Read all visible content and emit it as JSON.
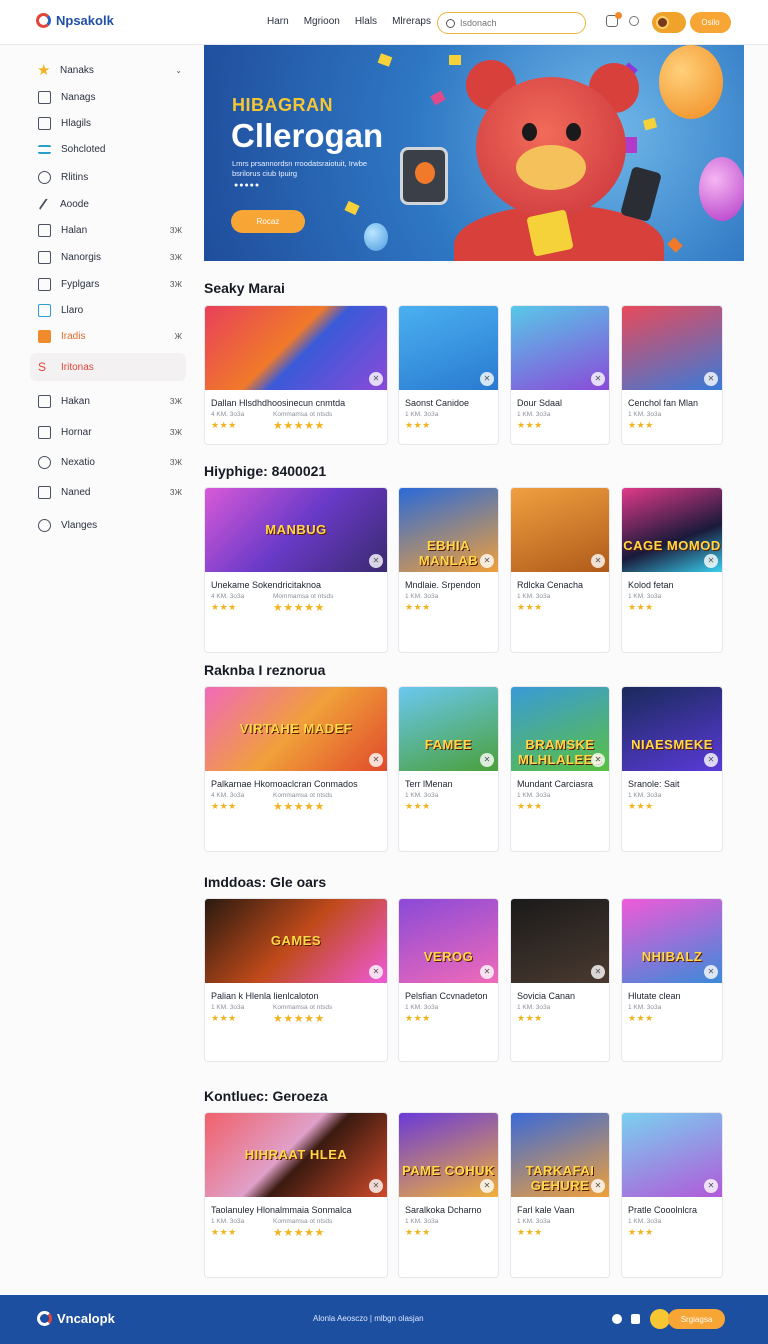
{
  "header": {
    "logo_text": "Npsakolk",
    "nav": [
      "Harn",
      "Mgrioon",
      "Hlals",
      "Mlreraps"
    ],
    "search_placeholder": "Isdonach",
    "login_label": "Osilo"
  },
  "sidebar": {
    "items": [
      {
        "label": "Nanaks",
        "tail": "⌄"
      },
      {
        "label": "Nanags",
        "tail": ""
      },
      {
        "label": "Hlagils",
        "tail": ""
      },
      {
        "label": "Sohcloted",
        "tail": ""
      },
      {
        "label": "Rlitins",
        "tail": ""
      },
      {
        "label": "Aoode",
        "tail": ""
      },
      {
        "label": "Halan",
        "tail": "ЗЖ"
      },
      {
        "label": "Nanorgis",
        "tail": "ЗЖ"
      },
      {
        "label": "Fyplgars",
        "tail": "ЗЖ"
      },
      {
        "label": "Llaro",
        "tail": ""
      },
      {
        "label": "Iradis",
        "tail": "Ж"
      },
      {
        "label": "Iritonas",
        "tail": ""
      },
      {
        "label": "Hakan",
        "tail": "ЗЖ"
      },
      {
        "label": "Hornar",
        "tail": "ЗЖ"
      },
      {
        "label": "Nexatio",
        "tail": "ЗЖ"
      },
      {
        "label": "Naned",
        "tail": "ЗЖ"
      },
      {
        "label": "Vlanges",
        "tail": ""
      }
    ]
  },
  "hero": {
    "kicker": "HIBAGRAN",
    "title": "Cllerogan",
    "subtitle": "Lmrs prsannordsn rroodatsraiotuit, Irwbe bsrilorus ciub Ipuirg",
    "dots": "●●●●●",
    "button": "Rocaz"
  },
  "sections": [
    {
      "title": "Seaky Marai",
      "cards": [
        {
          "title": "Dallan Hlsdhdhoosinecun cnmtda",
          "meta": "4 KM. 3o3a",
          "meta2": "Kommamsa ot ntsds",
          "wide": true
        },
        {
          "title": "Saonst Canidoe",
          "meta": "1 KM. 3o3a"
        },
        {
          "title": "Dour Sdaal",
          "meta": "1 KM. 3o3a"
        },
        {
          "title": "Cenchol fan Mlan",
          "meta": "1 KM. 3o3a"
        }
      ]
    },
    {
      "title": "Hiyphige: 8400021",
      "cards": [
        {
          "title": "Unekame Sokendricitaknoa",
          "meta": "4 KM. 3o3a",
          "meta2": "Mommamsa ot ntsds",
          "wide": true,
          "thumb": "MANBUG"
        },
        {
          "title": "Mndlaie. Srpendon",
          "meta": "1 KM. 3o3a",
          "thumb": "EBHIA MANLAB"
        },
        {
          "title": "Rdlcka Cenacha",
          "meta": "1 KM. 3o3a"
        },
        {
          "title": "Kolod fetan",
          "meta": "1 KM. 3o3a",
          "thumb": "CAGE MOMOD"
        }
      ]
    },
    {
      "title": "Raknba I reznorua",
      "cards": [
        {
          "title": "Palkarnae Hkomoaclcran Conmados",
          "meta": "4 KM. 3o3a",
          "meta2": "Kommamsa ot ntsds",
          "wide": true,
          "thumb": "VIRTAHE MADEF"
        },
        {
          "title": "Terr lMenan",
          "meta": "1 KM. 3o3a",
          "thumb": "FAMEE"
        },
        {
          "title": "Mundant Carciasra",
          "meta": "1 KM. 3o3a",
          "thumb": "BRAMSKE MLHLALEES"
        },
        {
          "title": "Sranole: Sait",
          "meta": "1 KM. 3o3a",
          "thumb": "NIAESMEKE"
        }
      ]
    },
    {
      "title": "Imddoas: Gle oars",
      "cards": [
        {
          "title": "Palian k Hlenla lienlcaloton",
          "meta": "1 KM. 3o3a",
          "meta2": "Kommamsa ot ntsds",
          "wide": true,
          "thumb": "GAMES"
        },
        {
          "title": "Pelsfian Ccvnadeton",
          "meta": "1 KM. 3o3a",
          "thumb": "VEROG"
        },
        {
          "title": "Sovicia Canan",
          "meta": "1 KM. 3o3a"
        },
        {
          "title": "Hlutate clean",
          "meta": "1 KM. 3o3a",
          "thumb": "NHIBALZ"
        }
      ]
    },
    {
      "title": "Kontluec: Geroeza",
      "cards": [
        {
          "title": "Taolanuley Hlonalmmaia Sonmalca",
          "meta": "1 KM. 3o3a",
          "meta2": "Kommamsa ot ntsds",
          "wide": true,
          "thumb": "HIHRAAT HLEA"
        },
        {
          "title": "Saralkoka Dcharno",
          "meta": "1 KM. 3o3a",
          "thumb": "PAME COHUK"
        },
        {
          "title": "Farl kale Vaan",
          "meta": "1 KM. 3o3a",
          "thumb": "TARKAFAI GEHURE"
        },
        {
          "title": "Pratle Cooolnlcra",
          "meta": "1 KM. 3o3a"
        }
      ]
    }
  ],
  "footer": {
    "logo_text": "Vncalopk",
    "links": "Alonla Aeosczo | mlbgn olasjan",
    "button": "Srgiagsa"
  }
}
